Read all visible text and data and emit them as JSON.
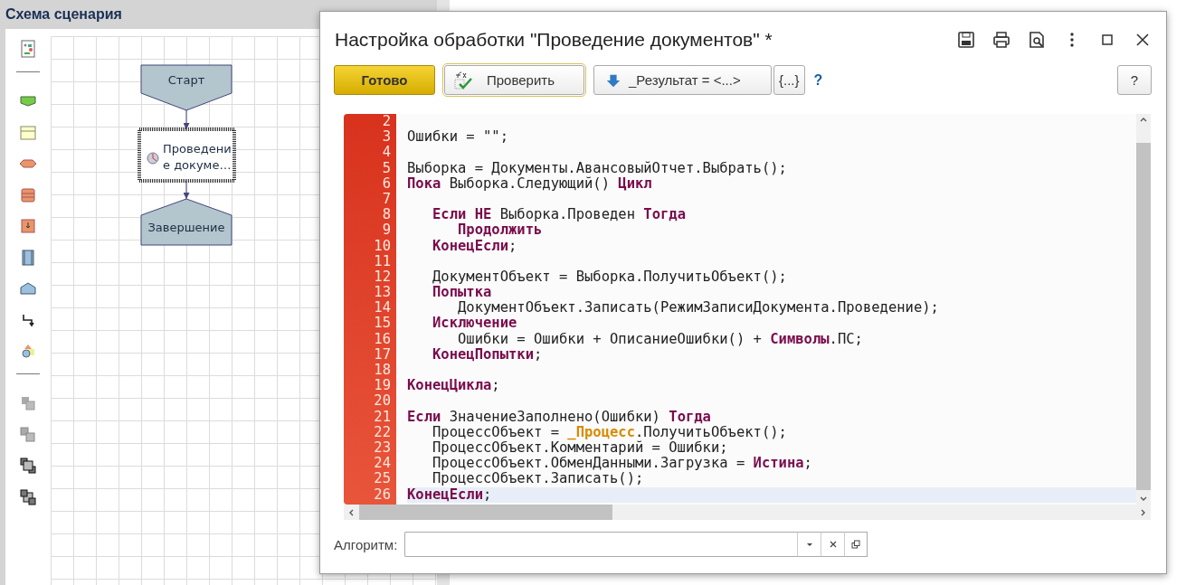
{
  "panel": {
    "title": "Схема сценария"
  },
  "diagram": {
    "nodes": [
      {
        "kind": "start",
        "lines": [
          "Старт"
        ],
        "selected": false
      },
      {
        "kind": "task",
        "lines": [
          "Проведени",
          "е  докуме…"
        ],
        "selected": true
      },
      {
        "kind": "end",
        "lines": [
          "Завершение"
        ],
        "selected": false
      }
    ]
  },
  "dialog": {
    "title": "Настройка обработки \"Проведение документов\" *",
    "toolbar": [
      {
        "kind": "primary",
        "label": "Готово"
      },
      {
        "kind": "check",
        "label": "Проверить"
      },
      {
        "kind": "insert",
        "label": "_Результат = <...>"
      },
      {
        "kind": "braces",
        "label": "{...}"
      },
      {
        "kind": "link",
        "label": "?"
      },
      {
        "kind": "help",
        "label": "?"
      }
    ],
    "code": [
      {
        "number": "2",
        "current": false
      },
      {
        "number": "3",
        "current": false,
        "segments": [
          {
            "text": "Ошибки = \"\";",
            "kind": "plain"
          }
        ]
      },
      {
        "number": "4",
        "current": false
      },
      {
        "number": "5",
        "current": false,
        "segments": [
          {
            "text": "Выборка = Документы.АвансовыйОтчет.Выбрать();",
            "kind": "plain"
          }
        ]
      },
      {
        "number": "6",
        "current": false,
        "segments": [
          {
            "text": "Пока",
            "kind": "kw"
          },
          {
            "text": " Выборка.Следующий() ",
            "kind": "plain"
          },
          {
            "text": "Цикл",
            "kind": "kw"
          }
        ]
      },
      {
        "number": "7",
        "current": false
      },
      {
        "number": "8",
        "current": false,
        "segments": [
          {
            "text": "   Если НЕ",
            "kind": "kw"
          },
          {
            "text": " Выборка.Проведен ",
            "kind": "plain"
          },
          {
            "text": "Тогда",
            "kind": "kw"
          }
        ]
      },
      {
        "number": "9",
        "current": false,
        "segments": [
          {
            "text": "      Продолжить",
            "kind": "kw"
          }
        ]
      },
      {
        "number": "10",
        "current": false,
        "segments": [
          {
            "text": "   КонецЕсли",
            "kind": "kw"
          },
          {
            "text": ";",
            "kind": "plain"
          }
        ]
      },
      {
        "number": "11",
        "current": false
      },
      {
        "number": "12",
        "current": false,
        "segments": [
          {
            "text": "   ДокументОбъект = Выборка.ПолучитьОбъект();",
            "kind": "plain"
          }
        ]
      },
      {
        "number": "13",
        "current": false,
        "segments": [
          {
            "text": "   Попытка",
            "kind": "kw"
          }
        ]
      },
      {
        "number": "14",
        "current": false,
        "segments": [
          {
            "text": "      ДокументОбъект.Записать(РежимЗаписиДокумента.Проведение);",
            "kind": "plain"
          }
        ]
      },
      {
        "number": "15",
        "current": false,
        "segments": [
          {
            "text": "   Исключение",
            "kind": "kw"
          }
        ]
      },
      {
        "number": "16",
        "current": false,
        "segments": [
          {
            "text": "      Ошибки = Ошибки + ОписаниеОшибки() + ",
            "kind": "plain"
          },
          {
            "text": "Символы",
            "kind": "kw"
          },
          {
            "text": ".ПС;",
            "kind": "plain"
          }
        ]
      },
      {
        "number": "17",
        "current": false,
        "segments": [
          {
            "text": "   КонецПопытки",
            "kind": "kw"
          },
          {
            "text": ";",
            "kind": "plain"
          }
        ]
      },
      {
        "number": "18",
        "current": false
      },
      {
        "number": "19",
        "current": false,
        "segments": [
          {
            "text": "КонецЦикла",
            "kind": "kw"
          },
          {
            "text": ";",
            "kind": "plain"
          }
        ]
      },
      {
        "number": "20",
        "current": false
      },
      {
        "number": "21",
        "current": false,
        "segments": [
          {
            "text": "Если",
            "kind": "kw"
          },
          {
            "text": " ЗначениеЗаполнено(Ошибки) ",
            "kind": "plain"
          },
          {
            "text": "Тогда",
            "kind": "kw"
          }
        ]
      },
      {
        "number": "22",
        "current": false,
        "segments": [
          {
            "text": "   ПроцессОбъект = ",
            "kind": "plain"
          },
          {
            "text": "_Процесс",
            "kind": "proc"
          },
          {
            "text": ".ПолучитьОбъект();",
            "kind": "plain"
          }
        ]
      },
      {
        "number": "23",
        "current": false,
        "segments": [
          {
            "text": "   ПроцессОбъект.Комментарий = Ошибки;",
            "kind": "plain"
          }
        ]
      },
      {
        "number": "24",
        "current": false,
        "segments": [
          {
            "text": "   ПроцессОбъект.ОбменДанными.Загрузка = ",
            "kind": "plain"
          },
          {
            "text": "Истина",
            "kind": "kw"
          },
          {
            "text": ";",
            "kind": "plain"
          }
        ]
      },
      {
        "number": "25",
        "current": false,
        "segments": [
          {
            "text": "   ПроцессОбъект.Записать();",
            "kind": "plain"
          }
        ]
      },
      {
        "number": "26",
        "current": true,
        "segments": [
          {
            "text": "КонецЕсли",
            "kind": "kw"
          },
          {
            "text": ";",
            "kind": "plain"
          }
        ]
      }
    ],
    "algorithm": {
      "label": "Алгоритм:"
    }
  }
}
